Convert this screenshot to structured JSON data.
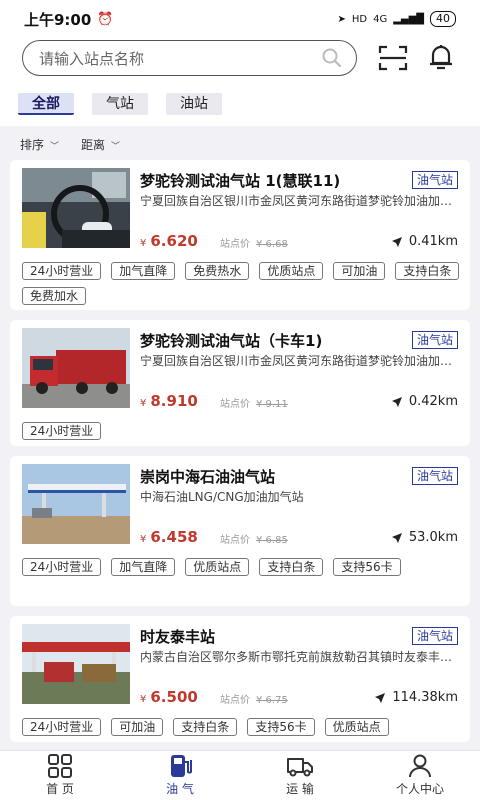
{
  "status_bar": {
    "time": "上午9:00",
    "signal_label": "4G",
    "hd_label": "HD",
    "battery": "40"
  },
  "search": {
    "placeholder": "请输入站点名称"
  },
  "filter_tabs": [
    {
      "label": "全部",
      "active": true
    },
    {
      "label": "气站",
      "active": false
    },
    {
      "label": "油站",
      "active": false
    }
  ],
  "sort": {
    "order_label": "排序",
    "distance_label": "距离",
    "chevron": "﹀"
  },
  "stations": [
    {
      "name": "梦驼铃测试油气站  1(慧联11)",
      "type": "油气站",
      "address": "宁夏回族自治区银川市金凤区黄河东路街道梦驼铃加油加气站",
      "price": "6.620",
      "currency": "¥",
      "station_price_label": "站点价",
      "station_price": "¥ 6.68",
      "distance": "0.41km",
      "thumb": "driver",
      "tags": [
        "24小时营业",
        "加气直降",
        "免费热水",
        "优质站点",
        "可加油",
        "支持白条",
        "免费加水"
      ]
    },
    {
      "name": "梦驼铃测试油气站（卡车1)",
      "type": "油气站",
      "address": "宁夏回族自治区银川市金凤区黄河东路街道梦驼铃加油加气站",
      "price": "8.910",
      "currency": "¥",
      "station_price_label": "站点价",
      "station_price": "¥ 9.11",
      "distance": "0.42km",
      "thumb": "red-truck",
      "tags": [
        "24小时营业"
      ]
    },
    {
      "name": "崇岗中海石油油气站",
      "type": "油气站",
      "address": "中海石油LNG/CNG加油加气站",
      "price": "6.458",
      "currency": "¥",
      "station_price_label": "站点价",
      "station_price": "¥ 6.85",
      "distance": "53.0km",
      "thumb": "gas-station",
      "tags": [
        "24小时营业",
        "加气直降",
        "优质站点",
        "支持白条",
        "支持56卡"
      ]
    },
    {
      "name": "时友泰丰站",
      "type": "油气站",
      "address": "内蒙古自治区鄂尔多斯市鄂托克前旗敖勒召其镇时友泰丰加油站",
      "price": "6.500",
      "currency": "¥",
      "station_price_label": "站点价",
      "station_price": "¥ 6.75",
      "distance": "114.38km",
      "thumb": "station-trucks",
      "tags": [
        "24小时营业",
        "可加油",
        "支持白条",
        "支持56卡",
        "优质站点"
      ]
    }
  ],
  "bottom_nav": [
    {
      "label": "首 页",
      "icon": "home-grid-icon",
      "active": false
    },
    {
      "label": "油 气",
      "icon": "fuel-pump-icon",
      "active": true
    },
    {
      "label": "运 输",
      "icon": "truck-icon",
      "active": false
    },
    {
      "label": "个人中心",
      "icon": "person-icon",
      "active": false
    }
  ],
  "colors": {
    "accent": "#2b3a9a",
    "price": "#c0392b",
    "tab_active_bg": "#dde1f6"
  }
}
